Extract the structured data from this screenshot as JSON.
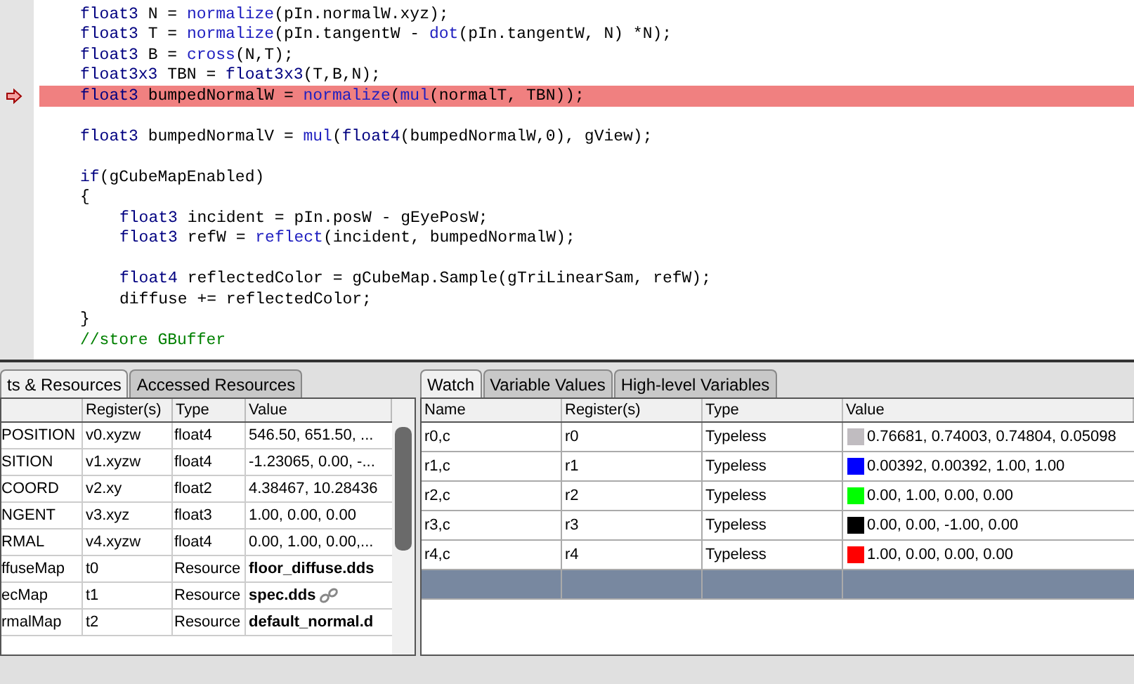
{
  "code": {
    "lines": [
      {
        "kind": "code",
        "current": false,
        "tokens": [
          {
            "kind": "kw",
            "t": "float3"
          },
          {
            "kind": "tx",
            "t": " N = "
          },
          {
            "kind": "fn",
            "t": "normalize"
          },
          {
            "kind": "tx",
            "t": "(pIn.normalW.xyz);"
          }
        ]
      },
      {
        "kind": "code",
        "current": false,
        "tokens": [
          {
            "kind": "kw",
            "t": "float3"
          },
          {
            "kind": "tx",
            "t": " T = "
          },
          {
            "kind": "fn",
            "t": "normalize"
          },
          {
            "kind": "tx",
            "t": "(pIn.tangentW - "
          },
          {
            "kind": "fn",
            "t": "dot"
          },
          {
            "kind": "tx",
            "t": "(pIn.tangentW, N) *N);"
          }
        ]
      },
      {
        "kind": "code",
        "current": false,
        "tokens": [
          {
            "kind": "kw",
            "t": "float3"
          },
          {
            "kind": "tx",
            "t": " B = "
          },
          {
            "kind": "fn",
            "t": "cross"
          },
          {
            "kind": "tx",
            "t": "(N,T);"
          }
        ]
      },
      {
        "kind": "code",
        "current": false,
        "tokens": [
          {
            "kind": "kw",
            "t": "float3x3"
          },
          {
            "kind": "tx",
            "t": " TBN = "
          },
          {
            "kind": "kw",
            "t": "float3x3"
          },
          {
            "kind": "tx",
            "t": "(T,B,N);"
          }
        ]
      },
      {
        "kind": "code",
        "current": true,
        "tokens": [
          {
            "kind": "kw",
            "t": "float3"
          },
          {
            "kind": "tx",
            "t": " bumpedNormalW = "
          },
          {
            "kind": "fn",
            "t": "normalize"
          },
          {
            "kind": "tx",
            "t": "("
          },
          {
            "kind": "fn",
            "t": "mul"
          },
          {
            "kind": "tx",
            "t": "(normalT, TBN));"
          }
        ]
      },
      {
        "kind": "blank"
      },
      {
        "kind": "code",
        "current": false,
        "tokens": [
          {
            "kind": "kw",
            "t": "float3"
          },
          {
            "kind": "tx",
            "t": " bumpedNormalV = "
          },
          {
            "kind": "fn",
            "t": "mul"
          },
          {
            "kind": "tx",
            "t": "("
          },
          {
            "kind": "kw",
            "t": "float4"
          },
          {
            "kind": "tx",
            "t": "(bumpedNormalW,0), gView);"
          }
        ]
      },
      {
        "kind": "blank"
      },
      {
        "kind": "code",
        "current": false,
        "tokens": [
          {
            "kind": "kw",
            "t": "if"
          },
          {
            "kind": "tx",
            "t": "(gCubeMapEnabled)"
          }
        ]
      },
      {
        "kind": "code",
        "current": false,
        "tokens": [
          {
            "kind": "tx",
            "t": "{"
          }
        ],
        "children": [
          {
            "kind": "code",
            "current": false,
            "tokens": [
              {
                "kind": "kw",
                "t": "float3"
              },
              {
                "kind": "tx",
                "t": " incident = pIn.posW - gEyePosW;"
              }
            ]
          },
          {
            "kind": "code",
            "current": false,
            "tokens": [
              {
                "kind": "kw",
                "t": "float3"
              },
              {
                "kind": "tx",
                "t": " refW = "
              },
              {
                "kind": "fn",
                "t": "reflect"
              },
              {
                "kind": "tx",
                "t": "(incident, bumpedNormalW);"
              }
            ]
          },
          {
            "kind": "blank"
          },
          {
            "kind": "code",
            "current": false,
            "tokens": [
              {
                "kind": "kw",
                "t": "float4"
              },
              {
                "kind": "tx",
                "t": " reflectedColor = gCubeMap.Sample(gTriLinearSam, refW);"
              }
            ]
          },
          {
            "kind": "code",
            "current": false,
            "tokens": [
              {
                "kind": "tx",
                "t": "diffuse += reflectedColor;"
              }
            ]
          }
        ]
      },
      {
        "kind": "code",
        "current": false,
        "tokens": [
          {
            "kind": "tx",
            "t": "}"
          }
        ]
      },
      {
        "kind": "code",
        "current": false,
        "tokens": [
          {
            "kind": "cm",
            "t": "//store GBuffer"
          }
        ]
      }
    ]
  },
  "left_panel": {
    "tabs": [
      {
        "label": "ts & Resources",
        "selected": true
      },
      {
        "label": "Accessed Resources",
        "selected": false
      }
    ],
    "columns": [
      "Register(s)",
      "Type",
      "Value"
    ],
    "rows": [
      {
        "name": "POSITION",
        "register": "v0.xyzw",
        "type": "float4",
        "value": "546.50, 651.50, ..."
      },
      {
        "name": "SITION",
        "register": "v1.xyzw",
        "type": "float4",
        "value": "-1.23065, 0.00, -..."
      },
      {
        "name": "COORD",
        "register": "v2.xy",
        "type": "float2",
        "value": "4.38467, 10.28436"
      },
      {
        "name": "NGENT",
        "register": "v3.xyz",
        "type": "float3",
        "value": "1.00, 0.00, 0.00"
      },
      {
        "name": "RMAL",
        "register": "v4.xyzw",
        "type": "float4",
        "value": "0.00, 1.00, 0.00,..."
      },
      {
        "name": "ffuseMap",
        "register": "t0",
        "type": "Resource",
        "value": "floor_diffuse.dds",
        "kind": "resource"
      },
      {
        "name": "ecMap",
        "register": "t1",
        "type": "Resource",
        "value": "spec.dds",
        "kind": "linked"
      },
      {
        "name": "rmalMap",
        "register": "t2",
        "type": "Resource",
        "value": "default_normal.d",
        "kind": "resource"
      }
    ]
  },
  "right_panel": {
    "tabs": [
      {
        "label": "Watch",
        "selected": true
      },
      {
        "label": "Variable Values",
        "selected": false
      },
      {
        "label": "High-level Variables",
        "selected": false
      }
    ],
    "columns": [
      "Name",
      "Register(s)",
      "Type",
      "Value"
    ],
    "rows": [
      {
        "name": "r0,c",
        "register": "r0",
        "type": "Typeless",
        "color": "#c0bcc0",
        "value": "0.76681, 0.74003, 0.74804, 0.05098",
        "selected": false
      },
      {
        "name": "r1,c",
        "register": "r1",
        "type": "Typeless",
        "color": "#0000ff",
        "value": "0.00392, 0.00392, 1.00, 1.00",
        "selected": false
      },
      {
        "name": "r2,c",
        "register": "r2",
        "type": "Typeless",
        "color": "#00ff00",
        "value": "0.00, 1.00, 0.00, 0.00",
        "selected": false
      },
      {
        "name": "r3,c",
        "register": "r3",
        "type": "Typeless",
        "color": "#000000",
        "value": "0.00, 0.00, -1.00, 0.00",
        "selected": false
      },
      {
        "name": "r4,c",
        "register": "r4",
        "type": "Typeless",
        "color": "#ff0000",
        "value": "1.00, 0.00, 0.00, 0.00",
        "selected": false
      },
      {
        "selected": true
      }
    ]
  }
}
